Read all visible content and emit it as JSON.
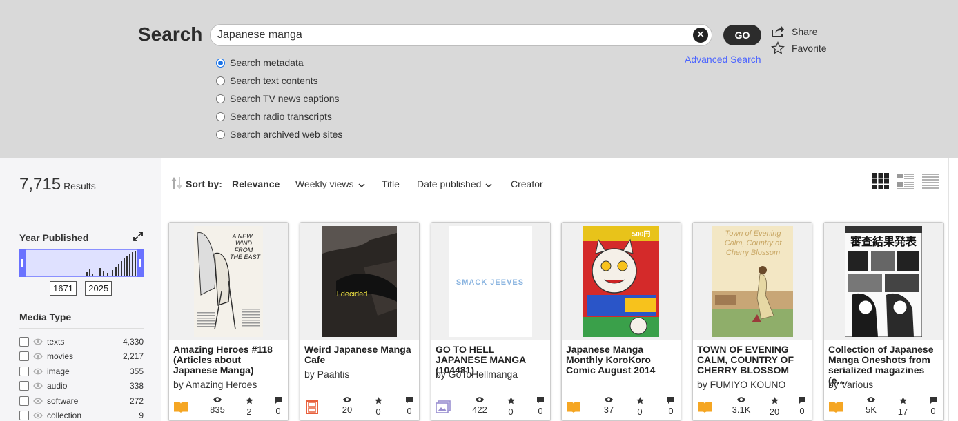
{
  "search": {
    "heading": "Search",
    "query": "Japanese manga",
    "go_label": "GO",
    "share_label": "Share",
    "favorite_label": "Favorite",
    "advanced_label": "Advanced Search",
    "options": [
      {
        "label": "Search metadata",
        "selected": true
      },
      {
        "label": "Search text contents",
        "selected": false
      },
      {
        "label": "Search TV news captions",
        "selected": false
      },
      {
        "label": "Search radio transcripts",
        "selected": false
      },
      {
        "label": "Search archived web sites",
        "selected": false
      }
    ]
  },
  "results": {
    "count": "7,715",
    "label": "Results"
  },
  "facets": {
    "year": {
      "title": "Year Published",
      "min": "1671",
      "max": "2025"
    },
    "media": {
      "title": "Media Type",
      "items": [
        {
          "label": "texts",
          "count": "4,330"
        },
        {
          "label": "movies",
          "count": "2,217"
        },
        {
          "label": "image",
          "count": "355"
        },
        {
          "label": "audio",
          "count": "338"
        },
        {
          "label": "software",
          "count": "272"
        },
        {
          "label": "collection",
          "count": "9"
        }
      ]
    }
  },
  "sort": {
    "label": "Sort by:",
    "options": [
      "Relevance",
      "Weekly views",
      "Title",
      "Date published",
      "Creator"
    ]
  },
  "colors": {
    "accent": "#4b64ff",
    "range": "#6a72ff",
    "texts_badge": "#f5a623",
    "movies_badge": "#e8603c",
    "image_badge": "#9a8fd0"
  },
  "cards": [
    {
      "title": "Amazing Heroes #118 (Articles about Japanese Manga)",
      "creator": "by Amazing Heroes",
      "views": "835",
      "favorites": "2",
      "reviews": "0",
      "media": "texts",
      "thumb_text": "A NEW WIND FROM THE EAST"
    },
    {
      "title": "Weird Japanese Manga Cafe",
      "creator": "by Paahtis",
      "views": "20",
      "favorites": "0",
      "reviews": "0",
      "media": "movies",
      "thumb_text": "I decided"
    },
    {
      "title": "GO TO HELL JAPANESE MANGA (104481)",
      "creator": "by GoToHellmanga",
      "views": "422",
      "favorites": "0",
      "reviews": "0",
      "media": "image",
      "thumb_text": "SMACK JEEVES"
    },
    {
      "title": "Japanese Manga Monthly KoroKoro Comic August 2014",
      "creator": "",
      "views": "37",
      "favorites": "0",
      "reviews": "0",
      "media": "texts",
      "thumb_text": "500円"
    },
    {
      "title": "TOWN OF EVENING CALM, COUNTRY OF CHERRY BLOSSOM",
      "creator": "by FUMIYO KOUNO",
      "views": "3.1K",
      "favorites": "20",
      "reviews": "0",
      "media": "texts",
      "thumb_text": "Town of Evening Calm Country of Cherry Blossom"
    },
    {
      "title": "Collection of Japanese Manga Oneshots from serialized magazines (e...",
      "creator": "by Various",
      "views": "5K",
      "favorites": "17",
      "reviews": "0",
      "media": "texts",
      "thumb_text": "審査結果発表"
    }
  ]
}
